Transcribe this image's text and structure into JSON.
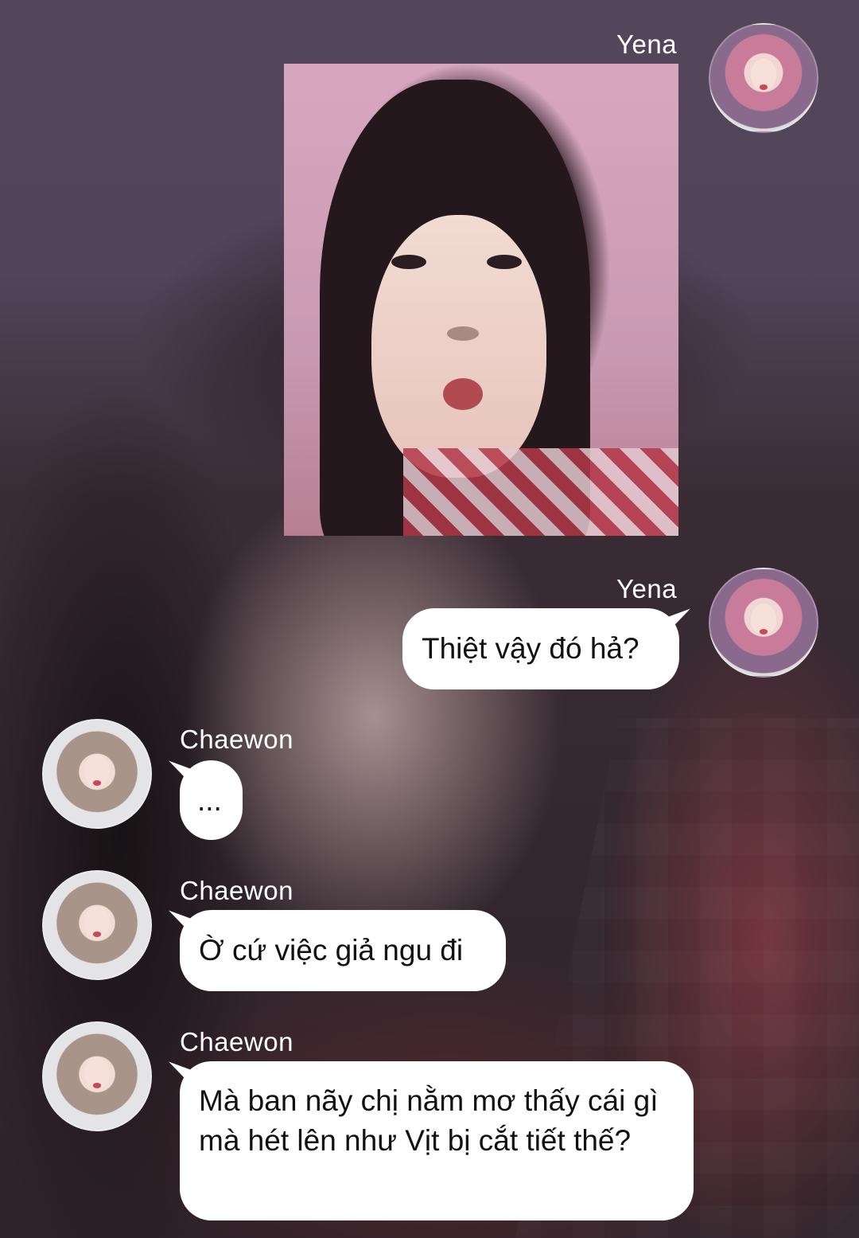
{
  "messages": [
    {
      "sender": "Yena",
      "type": "image"
    },
    {
      "sender": "Yena",
      "text": "Thiệt vậy đó hả?"
    },
    {
      "sender": "Chaewon",
      "text": "..."
    },
    {
      "sender": "Chaewon",
      "text": "Ờ cứ việc giả ngu đi"
    },
    {
      "sender": "Chaewon",
      "text": "Mà ban nãy chị nằm mơ thấy cái gì mà hét lên như Vịt bị cắt tiết thế?"
    }
  ],
  "colors": {
    "bubble": "#ffffff",
    "text": "#111111",
    "name_text": "#ffffff"
  },
  "icons": {
    "yena_avatar": "avatar-photo",
    "chaewon_avatar": "avatar-photo"
  }
}
